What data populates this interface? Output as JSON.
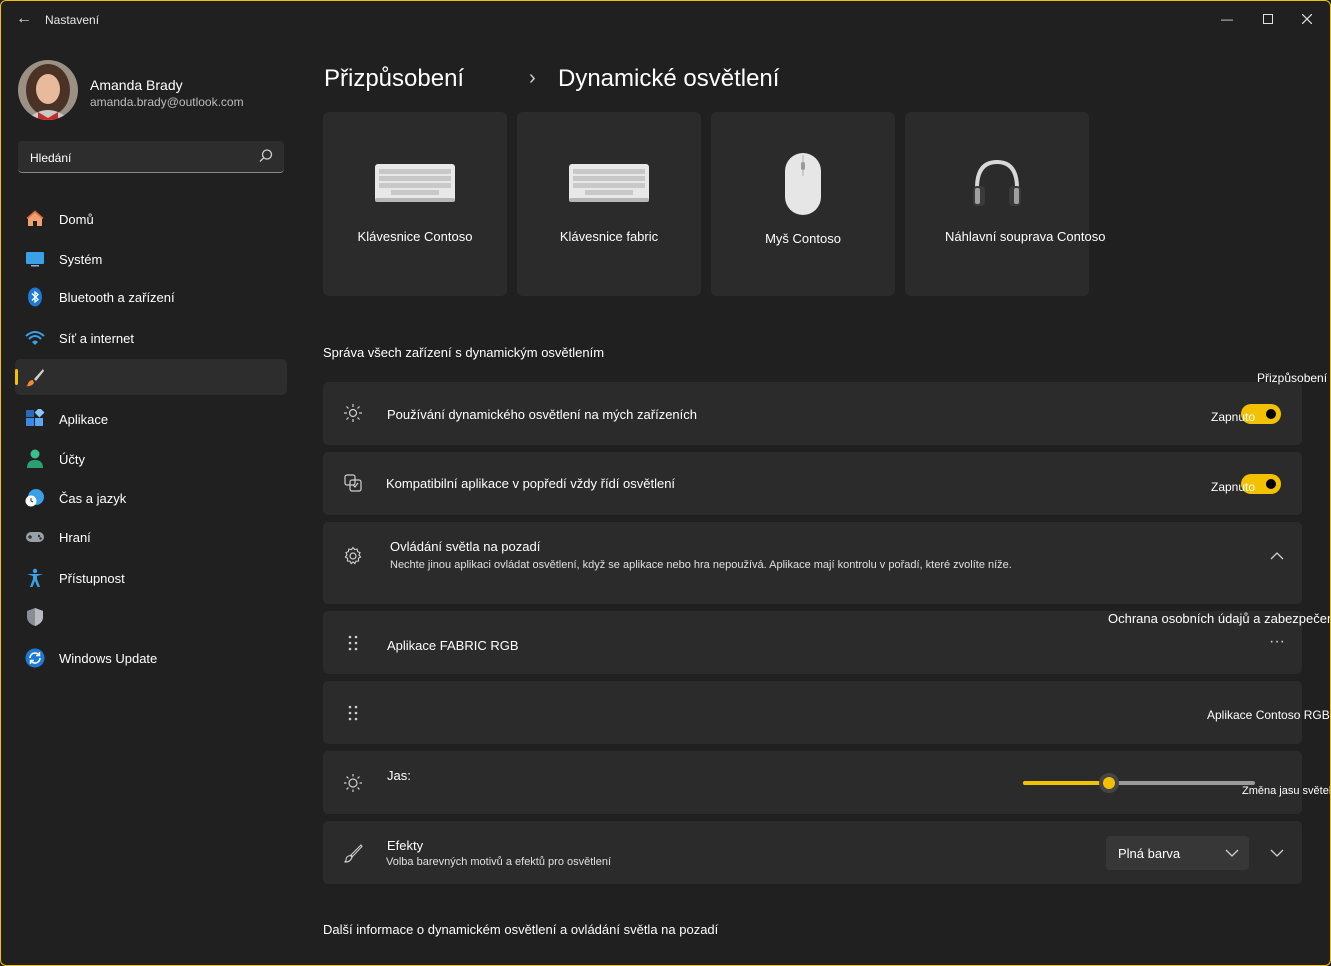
{
  "window": {
    "title": "Nastavení"
  },
  "colors": {
    "accent": "#f2c200",
    "background": "#202020",
    "card": "#2b2b2b"
  },
  "titlebar_icons": [
    "back-arrow-icon",
    "minimize-icon",
    "maximize-icon",
    "close-icon"
  ],
  "user": {
    "name": "Amanda Brady",
    "email": "amanda.brady@outlook.com"
  },
  "search": {
    "text": "Hledání",
    "icon": "search-icon"
  },
  "nav": {
    "items": [
      {
        "label": "Domů",
        "icon": "home-icon"
      },
      {
        "label": "Systém",
        "icon": "monitor-icon"
      },
      {
        "label": "Bluetooth a zařízení",
        "icon": "bluetooth-icon"
      },
      {
        "label": "Síť a internet",
        "icon": "wifi-icon"
      },
      {
        "label": "",
        "icon": "paintbrush-icon",
        "selected": true
      },
      {
        "label": "Aplikace",
        "icon": "apps-icon"
      },
      {
        "label": "Účty",
        "icon": "person-icon"
      },
      {
        "label": "Čas a jazyk",
        "icon": "clock-globe-icon"
      },
      {
        "label": "Hraní",
        "icon": "gamepad-icon"
      },
      {
        "label": "Přístupnost",
        "icon": "accessibility-icon"
      },
      {
        "label": "",
        "icon": "shield-icon"
      },
      {
        "label": "Windows Update",
        "icon": "update-icon"
      }
    ]
  },
  "header": {
    "parent": "Přizpůsobení",
    "current": "Dynamické osvětlení"
  },
  "devices": [
    {
      "label": "Klávesnice Contoso",
      "icon": "keyboard-icon"
    },
    {
      "label": "Klávesnice fabric",
      "icon": "keyboard-icon"
    },
    {
      "label": "Myš Contoso",
      "icon": "mouse-icon"
    },
    {
      "label": "Náhlavní souprava Contoso",
      "icon": "headset-icon"
    }
  ],
  "section_title": "Správa všech zařízení s dynamickým osvětlením",
  "floating_labels": {
    "personalization": "Přizpůsobení",
    "privacy": "Ochrana osobních údajů a zabezpečení",
    "contoso_rgb": "Aplikace Contoso RGB",
    "brightness_change": "Změna jasu světel"
  },
  "settings": {
    "use_lighting": {
      "title": "Používání dynamického osvětlení na mých zařízeních",
      "state": "Zapnuto",
      "on": true
    },
    "compatible_apps": {
      "title": "Kompatibilní aplikace v popředí vždy řídí osvětlení",
      "state": "Zapnuto",
      "on": true
    },
    "background_control": {
      "title": "Ovládání světla na pozadí",
      "subtitle": "Nechte jinou aplikaci ovládat osvětlení, když se aplikace nebo hra nepoužívá. Aplikace mají kontrolu v pořadí, které zvolíte níže.",
      "expanded": true
    },
    "app_fabric": {
      "title": "Aplikace FABRIC RGB",
      "more": "···"
    },
    "brightness": {
      "title": "Jas:",
      "value": 0.37
    },
    "effects": {
      "title": "Efekty",
      "subtitle": "Volba barevných motivů a efektů pro osvětlení",
      "selected": "Plná barva"
    }
  },
  "footer_link": "Další informace o dynamickém osvětlení a ovládání světla na pozadí"
}
